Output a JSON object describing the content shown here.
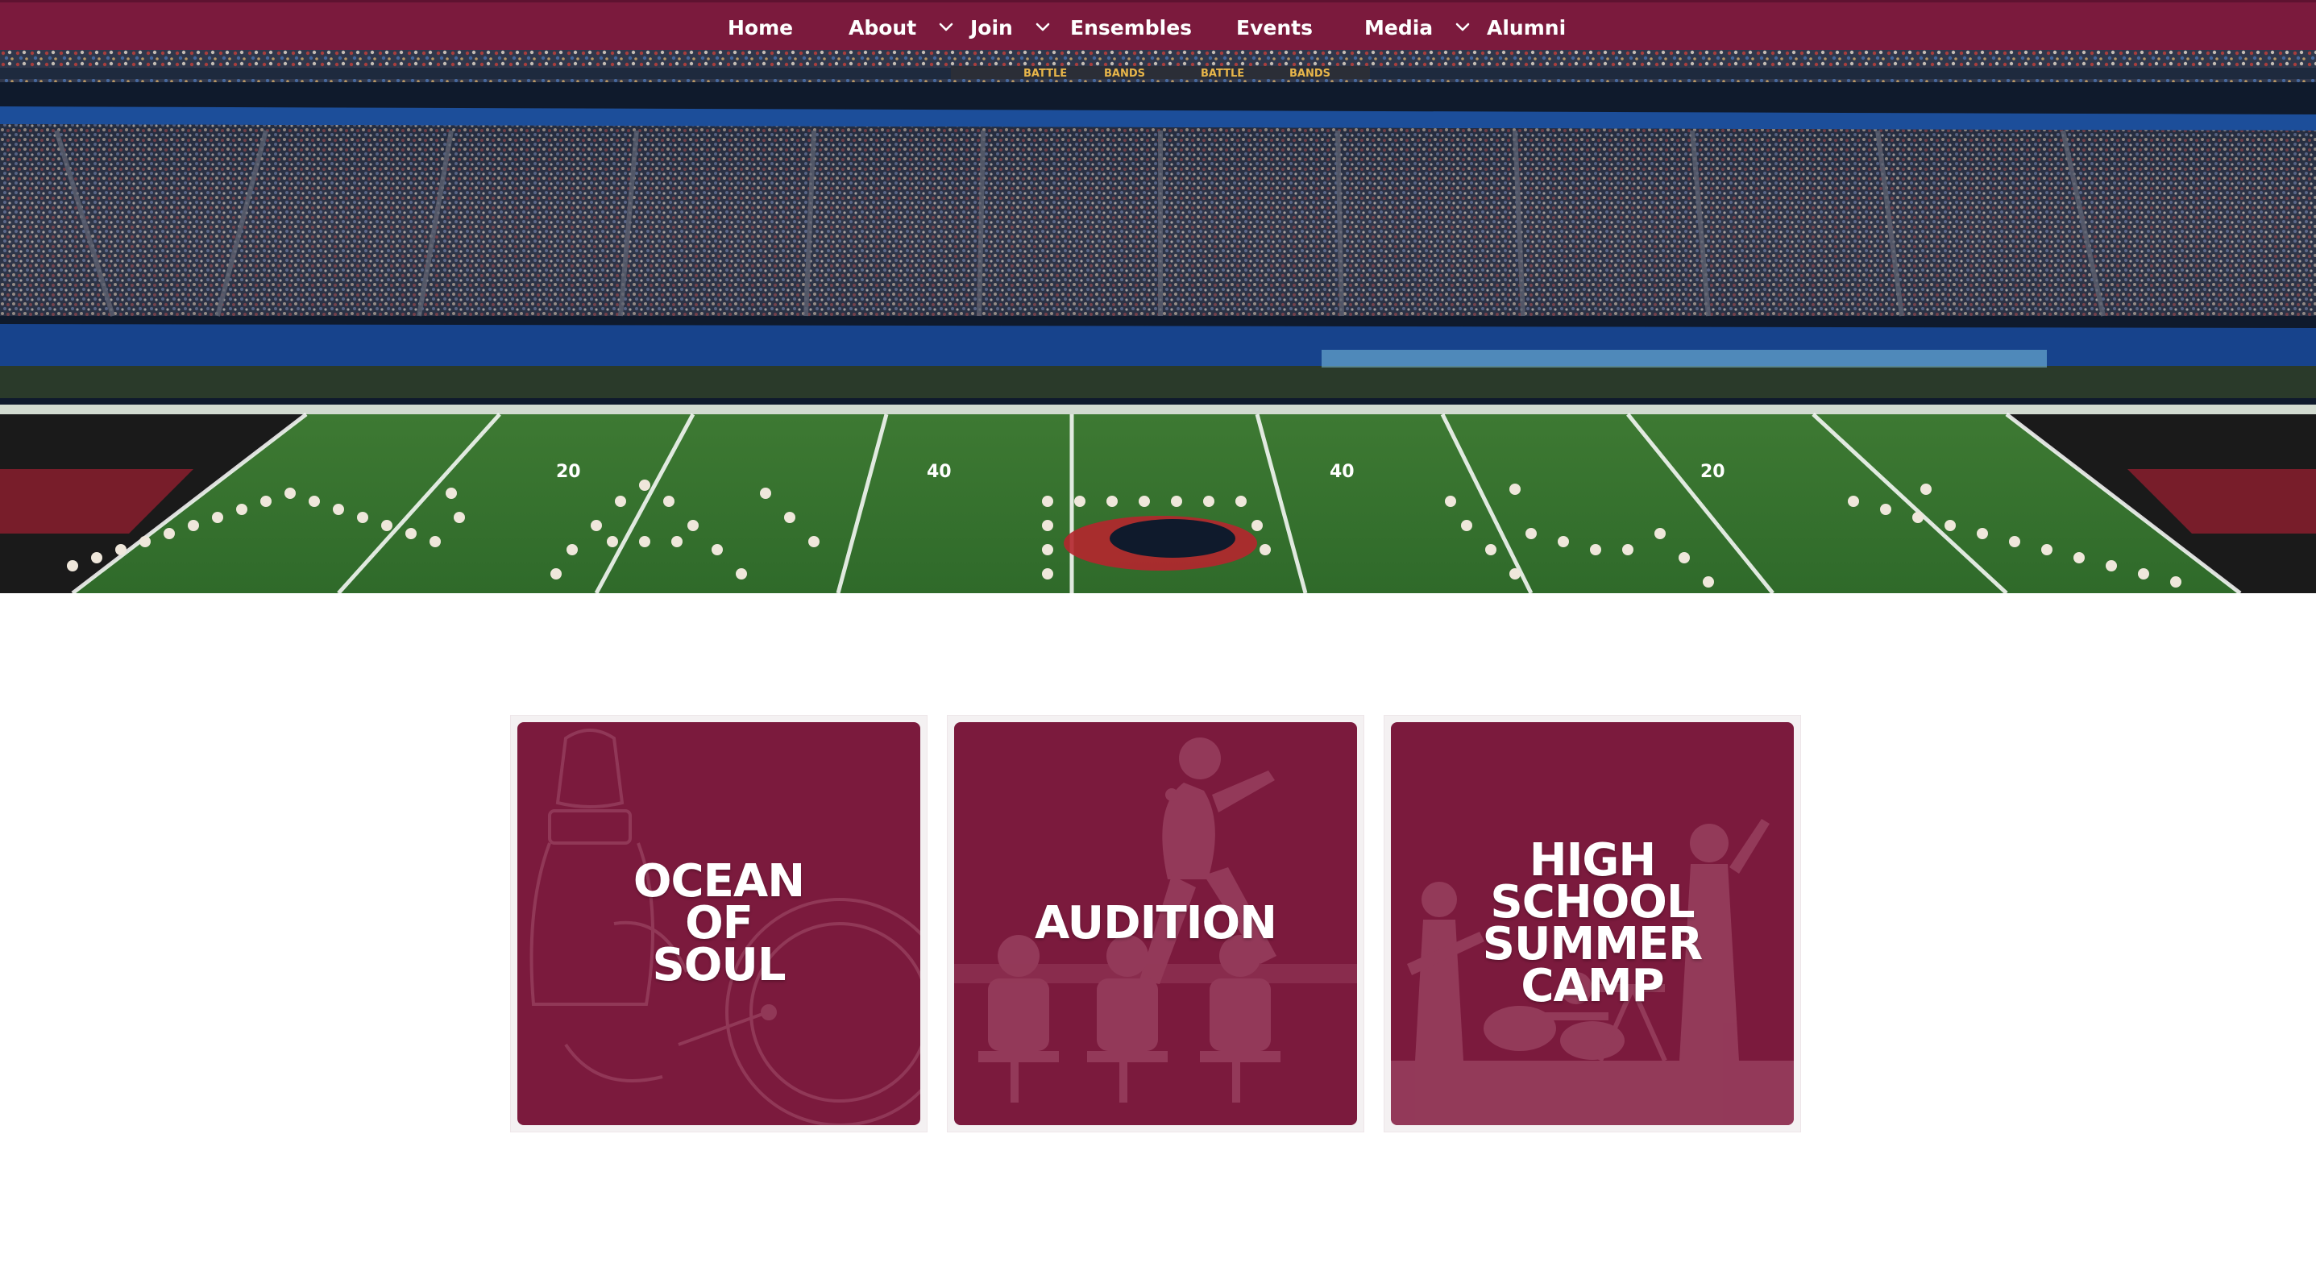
{
  "colors": {
    "brand_maroon": "#7b1a3d",
    "nav_text": "#ffffff",
    "card_title": "#ffffff",
    "page_background": "#ffffff"
  },
  "nav": {
    "items": [
      {
        "label": "Home",
        "has_dropdown": false
      },
      {
        "label": "About",
        "has_dropdown": true,
        "icon": "chevron-down-icon"
      },
      {
        "label": "Join",
        "has_dropdown": true,
        "icon": "chevron-down-icon"
      },
      {
        "label": "Ensembles",
        "has_dropdown": false
      },
      {
        "label": "Events",
        "has_dropdown": false
      },
      {
        "label": "Media",
        "has_dropdown": true,
        "icon": "chevron-down-icon"
      },
      {
        "label": "Alumni",
        "has_dropdown": false
      }
    ]
  },
  "hero": {
    "banner_text": [
      "BATTLE",
      "BANDS",
      "BATTLE",
      "BANDS"
    ],
    "yard_markers": [
      "20",
      "40",
      "40",
      "20"
    ]
  },
  "cards": [
    {
      "title": "OCEAN\nOF\nSOUL",
      "illustration": "drummer-icon"
    },
    {
      "title": "AUDITION",
      "illustration": "singer-judges-icon"
    },
    {
      "title": "HIGH\nSCHOOL\nSUMMER\nCAMP",
      "illustration": "band-stage-icon"
    }
  ]
}
